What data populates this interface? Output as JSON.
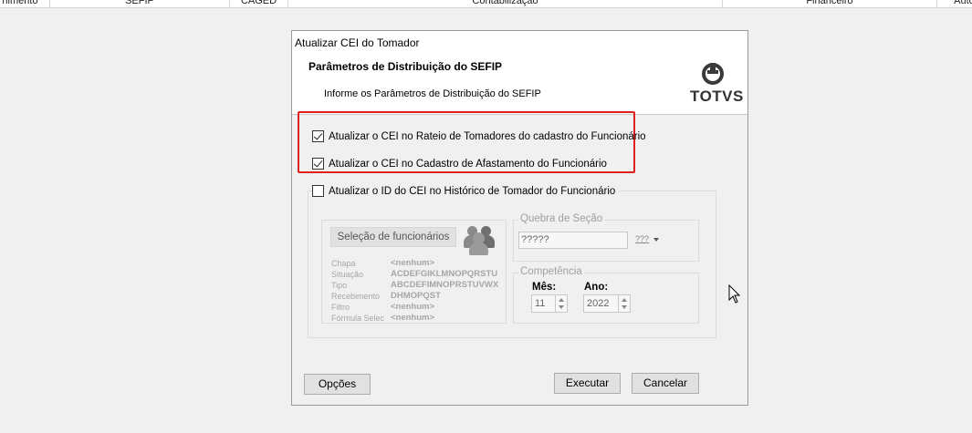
{
  "background_columns": [
    "nimento",
    "SEFIP",
    "CAGED",
    "Contabilização",
    "Financeiro",
    "Auto"
  ],
  "dialog": {
    "title": "Atualizar CEI do Tomador",
    "header_title": "Parâmetros de Distribuição do SEFIP",
    "header_subtitle": "Informe os Parâmetros de Distribuição do SEFIP",
    "logo_text": "TOTVS"
  },
  "options": [
    {
      "label": "Atualizar o CEI no Rateio de Tomadores do cadastro do Funcionário",
      "checked": true
    },
    {
      "label": "Atualizar o CEI no Cadastro de Afastamento do Funcionário",
      "checked": true
    },
    {
      "label": "Atualizar o ID do CEI no Histórico de Tomador do Funcionário",
      "checked": false
    }
  ],
  "selection": {
    "button": "Seleção de funcionários",
    "labels": [
      "Chapa",
      "Situação",
      "Tipo",
      "Recebimento",
      "Filtro",
      "Fórmula Selec"
    ],
    "values": [
      "<nenhum>",
      "ACDEFGIKLMNOPQRSTU",
      "ABCDEFIMNOPRSTUVWX",
      "DHMOPQST",
      "<nenhum>",
      "<nenhum>"
    ]
  },
  "quebra": {
    "legend": "Quebra de Seção",
    "value": "?????",
    "mini_button": "???"
  },
  "competencia": {
    "legend": "Competência",
    "mes_label": "Mês:",
    "mes_value": "11",
    "ano_label": "Ano:",
    "ano_value": "2022"
  },
  "buttons": {
    "opcoes": "Opções",
    "executar": "Executar",
    "cancelar": "Cancelar"
  },
  "colors": {
    "highlight": "#e02020"
  }
}
